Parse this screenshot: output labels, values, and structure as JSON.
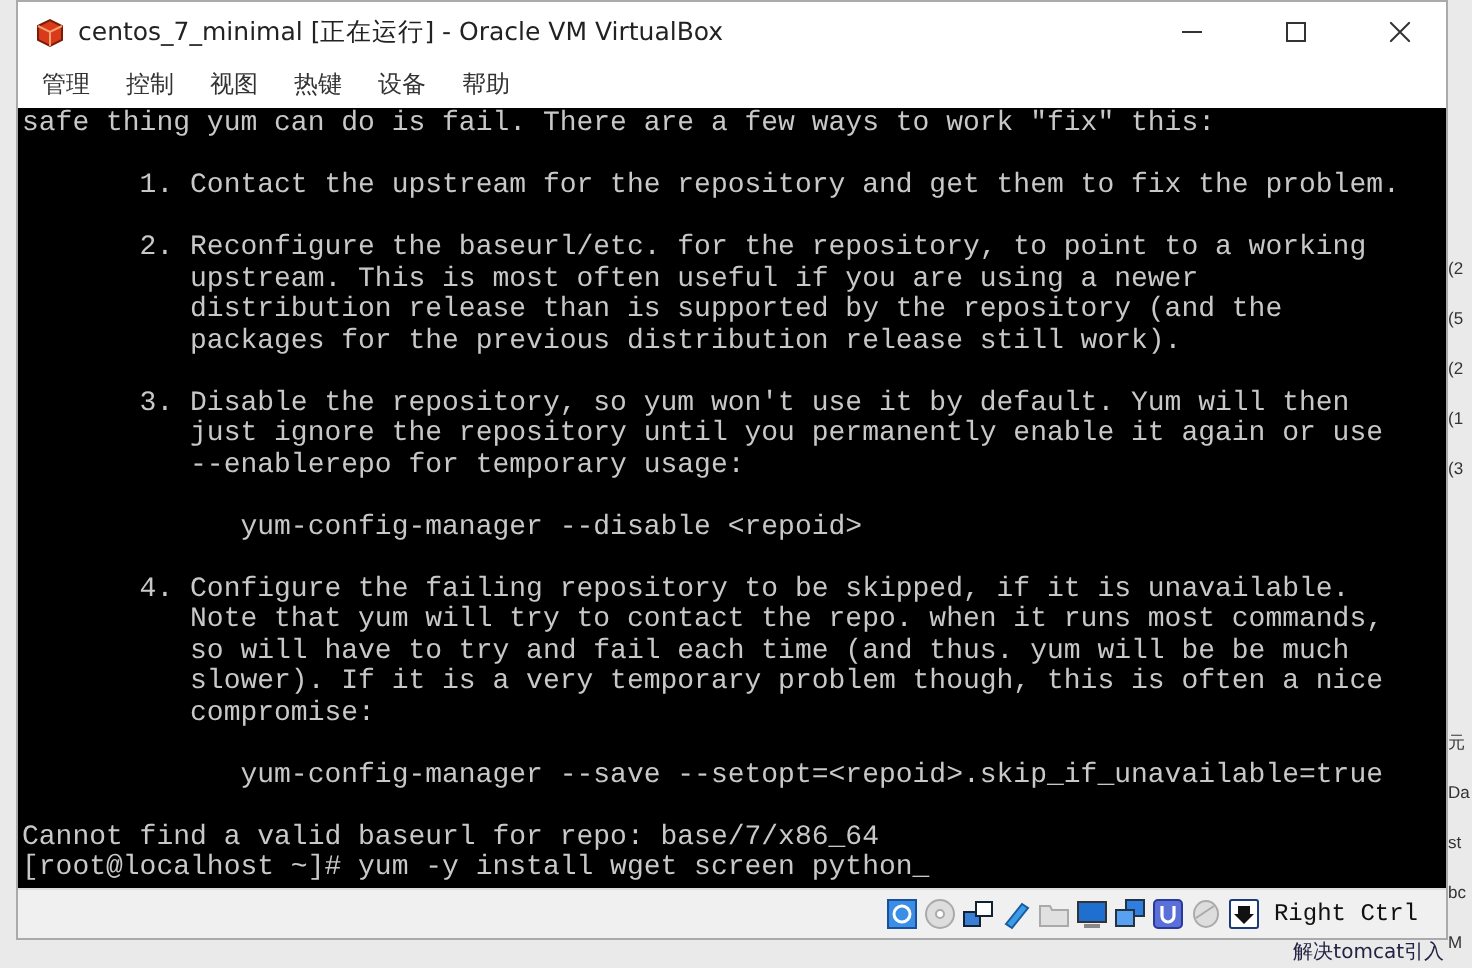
{
  "window": {
    "title": "centos_7_minimal [正在运行] - Oracle VM VirtualBox"
  },
  "menu": [
    "管理",
    "控制",
    "视图",
    "热键",
    "设备",
    "帮助"
  ],
  "terminal": {
    "blocks": [
      [
        "safe thing yum can do is fail. There are a few ways to work \"fix\" this:"
      ],
      [
        "       1. Contact the upstream for the repository and get them to fix the problem."
      ],
      [
        "       2. Reconfigure the baseurl/etc. for the repository, to point to a working",
        "          upstream. This is most often useful if you are using a newer",
        "          distribution release than is supported by the repository (and the",
        "          packages for the previous distribution release still work)."
      ],
      [
        "       3. Disable the repository, so yum won't use it by default. Yum will then",
        "          just ignore the repository until you permanently enable it again or use",
        "          --enablerepo for temporary usage:"
      ],
      [
        "             yum-config-manager --disable <repoid>"
      ],
      [
        "       4. Configure the failing repository to be skipped, if it is unavailable.",
        "          Note that yum will try to contact the repo. when it runs most commands,",
        "          so will have to try and fail each time (and thus. yum will be be much",
        "          slower). If it is a very temporary problem though, this is often a nice",
        "          compromise:"
      ],
      [
        "             yum-config-manager --save --setopt=<repoid>.skip_if_unavailable=true"
      ],
      [
        "Cannot find a valid baseurl for repo: base/7/x86_64",
        "[root@localhost ~]# yum -y install wget screen python_"
      ]
    ]
  },
  "status_bar": {
    "host_key": "Right Ctrl"
  },
  "background": {
    "side_fragments": [
      [
        "(2",
        "(5",
        "(2",
        "(1",
        "(3"
      ],
      [
        "元",
        "Da",
        "st",
        "bc",
        "M"
      ]
    ],
    "bottom_text": "解决tomcat引入"
  }
}
